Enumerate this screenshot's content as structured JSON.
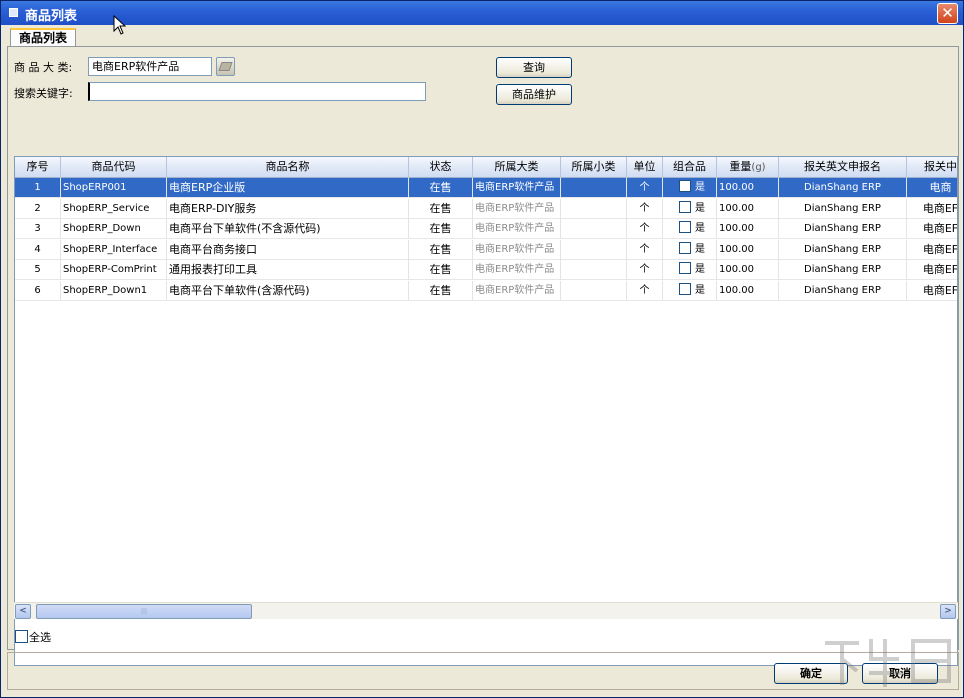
{
  "window": {
    "title": "商品列表",
    "close_glyph": "✕"
  },
  "tabs": [
    {
      "label": "商品列表"
    }
  ],
  "filters": {
    "category_label": "商 品 大 类:",
    "category_value": "电商ERP软件产品",
    "keyword_label": "搜索关键字:",
    "keyword_value": "",
    "query_button": "查询",
    "maintain_button": "商品维护"
  },
  "table": {
    "columns": [
      "序号",
      "商品代码",
      "商品名称",
      "状态",
      "所属大类",
      "所属小类",
      "单位",
      "组合品",
      "重量",
      "报关英文申报名",
      "报关中"
    ],
    "weight_unit": "(g)",
    "rows": [
      {
        "no": "1",
        "code": "ShopERP001",
        "name": "电商ERP企业版",
        "status": "在售",
        "category": "电商ERP软件产品",
        "subcategory": "",
        "unit": "个",
        "combo": "是",
        "weight": "100.00",
        "en_name": "DianShang ERP",
        "cn_decl": "电商",
        "selected": true
      },
      {
        "no": "2",
        "code": "ShopERP_Service",
        "name": "电商ERP-DIY服务",
        "status": "在售",
        "category": "电商ERP软件产品",
        "subcategory": "",
        "unit": "个",
        "combo": "是",
        "weight": "100.00",
        "en_name": "DianShang ERP",
        "cn_decl": "电商EF",
        "selected": false
      },
      {
        "no": "3",
        "code": "ShopERP_Down",
        "name": "电商平台下单软件(不含源代码)",
        "status": "在售",
        "category": "电商ERP软件产品",
        "subcategory": "",
        "unit": "个",
        "combo": "是",
        "weight": "100.00",
        "en_name": "DianShang ERP",
        "cn_decl": "电商EF",
        "selected": false
      },
      {
        "no": "4",
        "code": "ShopERP_Interface",
        "name": "电商平台商务接口",
        "status": "在售",
        "category": "电商ERP软件产品",
        "subcategory": "",
        "unit": "个",
        "combo": "是",
        "weight": "100.00",
        "en_name": "DianShang ERP",
        "cn_decl": "电商EF",
        "selected": false
      },
      {
        "no": "5",
        "code": "ShopERP-ComPrint",
        "name": "通用报表打印工具",
        "status": "在售",
        "category": "电商ERP软件产品",
        "subcategory": "",
        "unit": "个",
        "combo": "是",
        "weight": "100.00",
        "en_name": "DianShang ERP",
        "cn_decl": "电商EF",
        "selected": false
      },
      {
        "no": "6",
        "code": "ShopERP_Down1",
        "name": "电商平台下单软件(含源代码)",
        "status": "在售",
        "category": "电商ERP软件产品",
        "subcategory": "",
        "unit": "个",
        "combo": "是",
        "weight": "100.00",
        "en_name": "DianShang ERP",
        "cn_decl": "电商EF",
        "selected": false
      }
    ]
  },
  "scrollbar": {
    "left_arrow": "<",
    "right_arrow": ">",
    "thumb_grip": "|||"
  },
  "select_all_label": "全选",
  "footer": {
    "ok_button": "确定",
    "cancel_button": "取消"
  },
  "colors": {
    "titlebar": "#2a5fd6",
    "selection": "#3169c6",
    "panel": "#ece9d8"
  }
}
